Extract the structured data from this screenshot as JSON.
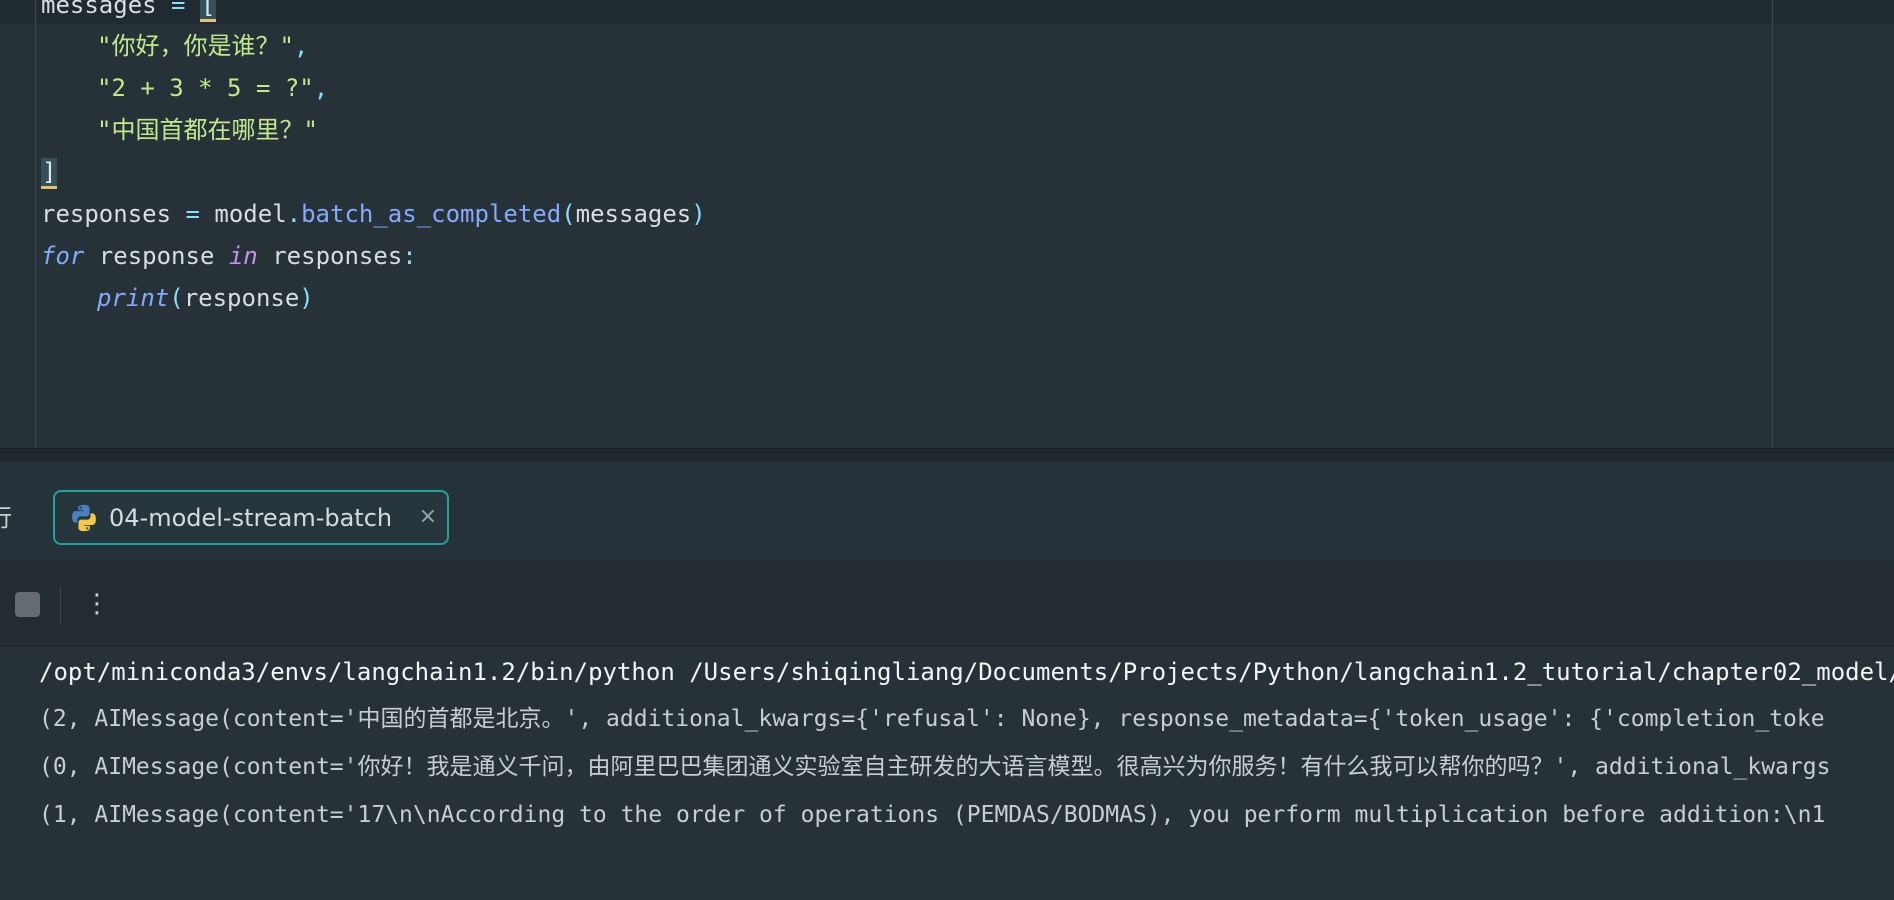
{
  "editor": {
    "line1": {
      "name": "messages",
      "op": "=",
      "bracket": "["
    },
    "line2": {
      "str": "\"你好，你是谁？\"",
      "comma": ","
    },
    "line3": {
      "str": "\"2 + 3 * 5 = ?\"",
      "comma": ","
    },
    "line4": {
      "str": "\"中国首都在哪里？\""
    },
    "line5": {
      "bracket": "]"
    },
    "line6": {
      "var": "responses",
      "op": "=",
      "obj": "model",
      "dot": ".",
      "method": "batch_as_completed",
      "lparen": "(",
      "arg": "messages",
      "rparen": ")"
    },
    "line7": {
      "kw_for": "for",
      "var": "response",
      "kw_in": "in",
      "iter": "responses",
      "colon": ":"
    },
    "line8": {
      "fn": "print",
      "lparen": "(",
      "arg": "response",
      "rparen": ")"
    }
  },
  "panel": {
    "cut_label": "行",
    "tab_label": "04-model-stream-batch",
    "tab_close": "×",
    "more_glyph": "⋮"
  },
  "console": {
    "command": "/opt/miniconda3/envs/langchain1.2/bin/python /Users/shiqingliang/Documents/Projects/Python/langchain1.2_tutorial/chapter02_model/",
    "outputs": [
      "(2, AIMessage(content='中国的首都是北京。', additional_kwargs={'refusal': None}, response_metadata={'token_usage': {'completion_toke",
      "(0, AIMessage(content='你好！我是通义千问，由阿里巴巴集团通义实验室自主研发的大语言模型。很高兴为你服务！有什么我可以帮你的吗？', additional_kwargs",
      "(1, AIMessage(content='17\\n\\nAccording to the order of operations (PEMDAS/BODMAS), you perform multiplication before addition:\\n1"
    ]
  },
  "colors": {
    "editor_bg": "#263238",
    "string": "#c3e88d",
    "function": "#82aaff",
    "keyword_in": "#c792ea",
    "tab_border": "#1fa39a"
  }
}
